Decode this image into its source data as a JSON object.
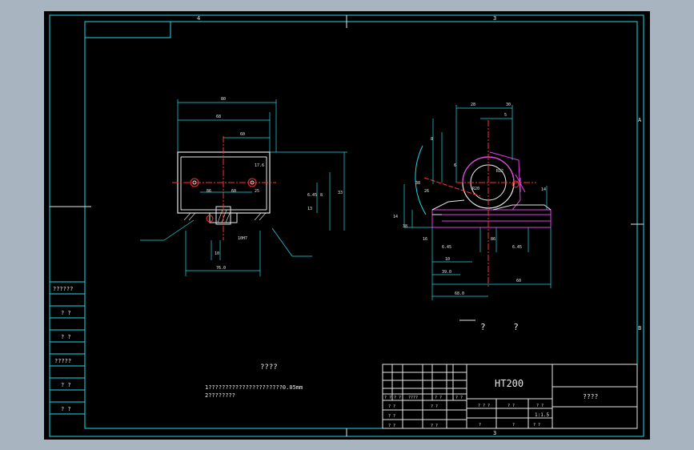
{
  "colors": {
    "frame": "#a9b4c1",
    "paper": "#000000",
    "border": "#23d8e6",
    "part": "#e6e6e6",
    "dim": "#23d8e6",
    "hidden": "#e040e0",
    "center": "#ff3030",
    "label": "#e8e8e8"
  },
  "zone_labels": {
    "top_left": "4",
    "top_right": "3",
    "bottom": "3",
    "right_a": "A",
    "right_b": "B"
  },
  "left_table": [
    "??????",
    "? ?",
    "? ?",
    "?????",
    "? ?",
    "? ?"
  ],
  "tech_req": {
    "title": "????",
    "line1": "1??????????????????????0.05mm",
    "line2": "2????????"
  },
  "view_labels": {
    "section": "? ?"
  },
  "title_block": {
    "material": "HT200",
    "company": "????",
    "scale": "1:1.5",
    "headers": [
      "? ?",
      "? ?",
      "????",
      "? ?",
      "? ?"
    ],
    "row_b": [
      "? ?",
      "? ?"
    ],
    "row_c": [
      "? ?",
      "? ?"
    ],
    "mid_row": [
      "? ? ?",
      "? ?",
      "? ?"
    ],
    "bottom_row": [
      "? ?",
      "?",
      "?",
      "? ?"
    ]
  },
  "dims_left": [
    "80",
    "68",
    "60",
    "17.6",
    "86",
    "60",
    "25",
    "33",
    "6.45",
    "8",
    "13",
    "10",
    "76.0",
    "10H7"
  ],
  "dims_right": [
    "30",
    "5",
    "28",
    "8",
    "R12",
    "6",
    "38",
    "R20",
    "26",
    "14",
    "38",
    "16",
    "14",
    "10",
    "60",
    "86",
    "6.45",
    "6.45",
    "39.0",
    "68.0"
  ]
}
